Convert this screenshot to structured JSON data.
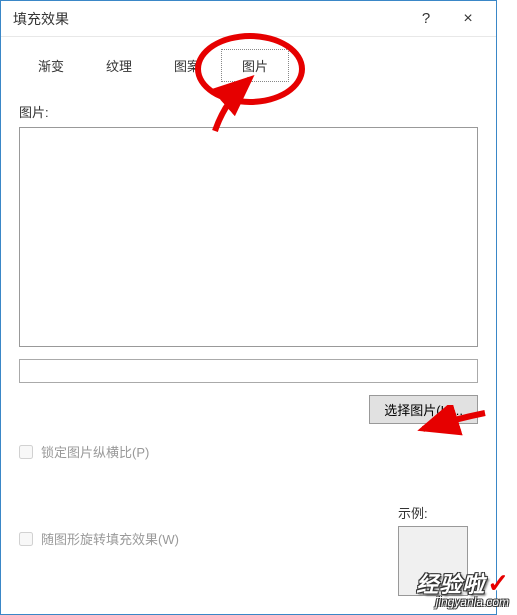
{
  "titlebar": {
    "title": "填充效果",
    "help": "?",
    "close": "×"
  },
  "tabs": [
    {
      "label": "渐变"
    },
    {
      "label": "纹理"
    },
    {
      "label": "图案"
    },
    {
      "label": "图片",
      "active": true
    }
  ],
  "picture": {
    "label": "图片:",
    "path_value": "",
    "select_button": "选择图片(L)..."
  },
  "checkboxes": {
    "lock_aspect": "锁定图片纵横比(P)",
    "rotate_fill": "随图形旋转填充效果(W)"
  },
  "sample": {
    "label": "示例:"
  },
  "watermark": {
    "main": "经验啦",
    "check": "✓",
    "sub": "jingyanla.com"
  }
}
